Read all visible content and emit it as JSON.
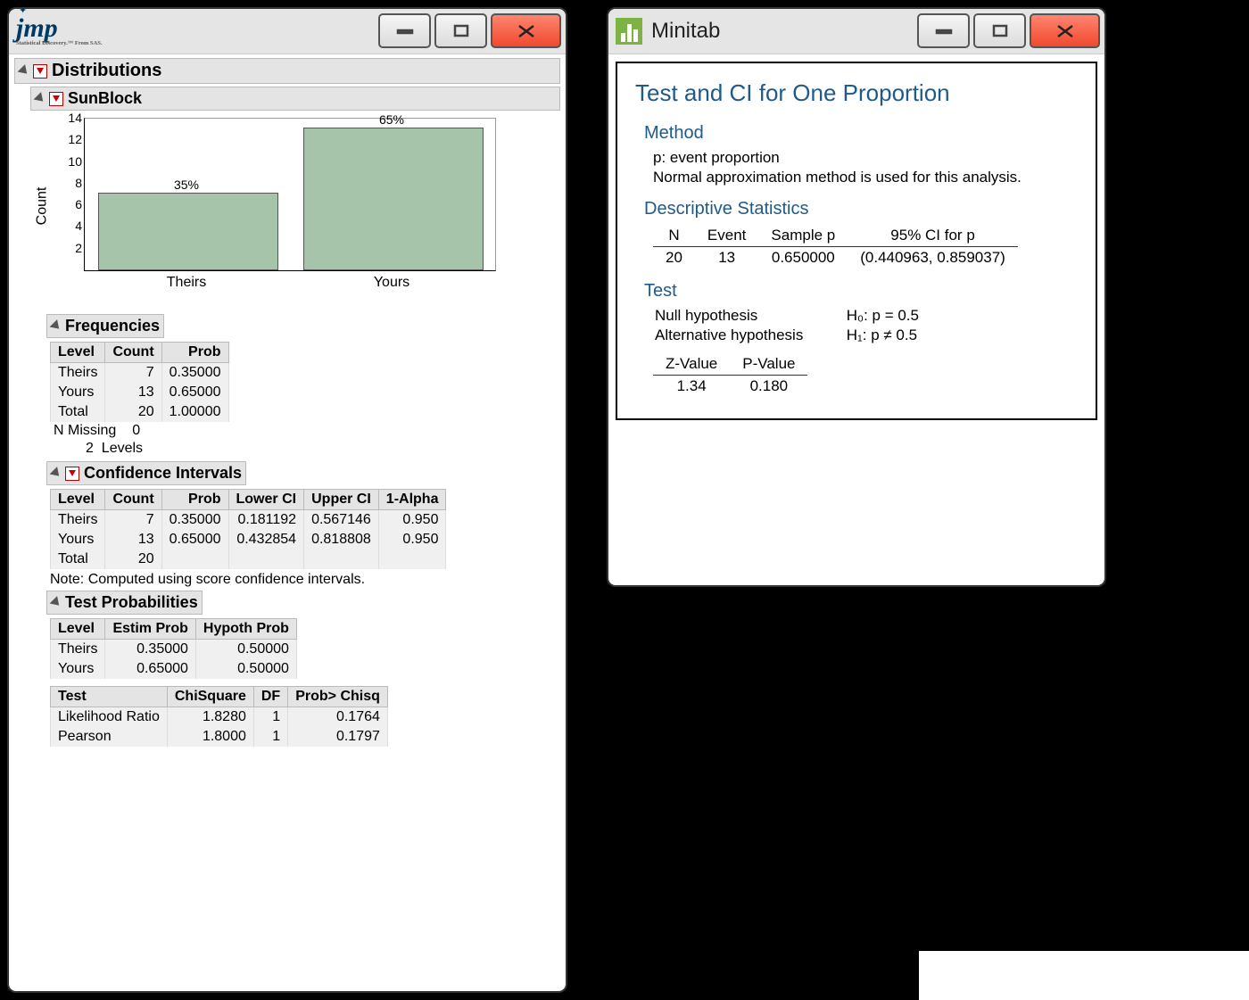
{
  "jmp": {
    "logo_text": "jmp",
    "logo_sub": "Statistical Discovery.™ From SAS.",
    "distributions": "Distributions",
    "sunblock": "SunBlock",
    "freq_title": "Frequencies",
    "ci_title": "Confidence Intervals",
    "tp_title": "Test Probabilities",
    "freq_headers": {
      "level": "Level",
      "count": "Count",
      "prob": "Prob"
    },
    "freq_rows": [
      {
        "level": "Theirs",
        "count": "7",
        "prob": "0.35000"
      },
      {
        "level": "Yours",
        "count": "13",
        "prob": "0.65000"
      },
      {
        "level": "Total",
        "count": "20",
        "prob": "1.00000"
      }
    ],
    "n_missing_label": "N Missing",
    "n_missing_val": "0",
    "levels_count": "2",
    "levels_label": "Levels",
    "ci_headers": {
      "level": "Level",
      "count": "Count",
      "prob": "Prob",
      "lower": "Lower CI",
      "upper": "Upper CI",
      "alpha": "1-Alpha"
    },
    "ci_rows": [
      {
        "level": "Theirs",
        "count": "7",
        "prob": "0.35000",
        "lower": "0.181192",
        "upper": "0.567146",
        "alpha": "0.950"
      },
      {
        "level": "Yours",
        "count": "13",
        "prob": "0.65000",
        "lower": "0.432854",
        "upper": "0.818808",
        "alpha": "0.950"
      },
      {
        "level": "Total",
        "count": "20",
        "prob": "",
        "lower": "",
        "upper": "",
        "alpha": ""
      }
    ],
    "ci_note": "Note: Computed using score confidence intervals.",
    "tp_headers": {
      "level": "Level",
      "estim": "Estim Prob",
      "hypoth": "Hypoth Prob"
    },
    "tp_rows": [
      {
        "level": "Theirs",
        "estim": "0.35000",
        "hypoth": "0.50000"
      },
      {
        "level": "Yours",
        "estim": "0.65000",
        "hypoth": "0.50000"
      }
    ],
    "test_headers": {
      "test": "Test",
      "chisq": "ChiSquare",
      "df": "DF",
      "pchisq": "Prob> Chisq"
    },
    "test_rows": [
      {
        "test": "Likelihood Ratio",
        "chisq": "1.8280",
        "df": "1",
        "pchisq": "0.1764"
      },
      {
        "test": "Pearson",
        "chisq": "1.8000",
        "df": "1",
        "pchisq": "0.1797"
      }
    ]
  },
  "mini": {
    "app": "Minitab",
    "title": "Test and CI for One Proportion",
    "method_h": "Method",
    "method_p1": "p: event proportion",
    "method_p2": "Normal approximation method is used for this analysis.",
    "desc_h": "Descriptive Statistics",
    "desc_headers": {
      "n": "N",
      "event": "Event",
      "samplep": "Sample p",
      "ci": "95% CI for p"
    },
    "desc_row": {
      "n": "20",
      "event": "13",
      "samplep": "0.650000",
      "ci": "(0.440963, 0.859037)"
    },
    "test_h": "Test",
    "null_label": "Null hypothesis",
    "null_val": "H₀: p = 0.5",
    "alt_label": "Alternative hypothesis",
    "alt_val": "H₁: p ≠ 0.5",
    "zv_headers": {
      "z": "Z-Value",
      "p": "P-Value"
    },
    "zv_row": {
      "z": "1.34",
      "p": "0.180"
    }
  },
  "chart_data": {
    "type": "bar",
    "title": "",
    "ylabel": "Count",
    "xlabel": "",
    "ylim": [
      0,
      14
    ],
    "yticks": [
      2,
      4,
      6,
      8,
      10,
      12,
      14
    ],
    "categories": [
      "Theirs",
      "Yours"
    ],
    "values": [
      7,
      13
    ],
    "percent_labels": [
      "35%",
      "65%"
    ]
  }
}
